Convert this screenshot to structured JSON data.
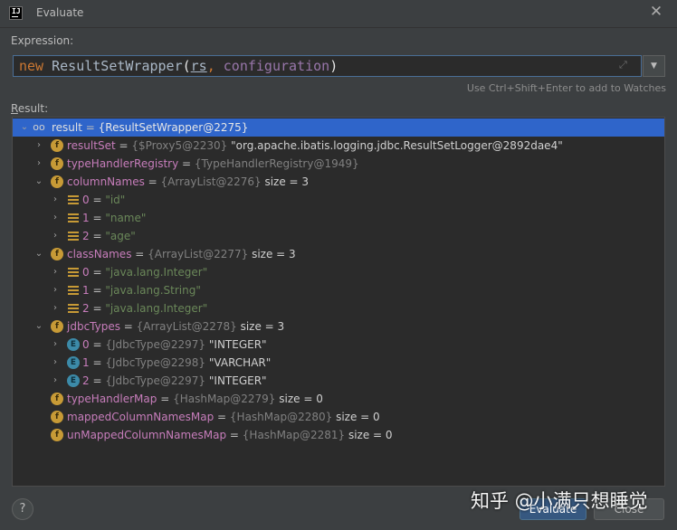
{
  "window": {
    "title": "Evaluate",
    "app_icon_text": "IJ"
  },
  "expression": {
    "label": "Expression:",
    "tokens": {
      "kw": "new",
      "cls": "ResultSetWrapper",
      "open": "(",
      "p1": "rs",
      "comma": ",",
      "p2": "configuration",
      "close": ")"
    },
    "hint": "Use Ctrl+Shift+Enter to add to Watches"
  },
  "result": {
    "label_u": "R",
    "label_rest": "esult:",
    "rows": [
      {
        "name": "result",
        "eq": " = ",
        "type": "{ResultSetWrapper@2275}",
        "tail": ""
      },
      {
        "name": "resultSet",
        "eq": " = ",
        "type": "{$Proxy5@2230}",
        "tail": " \"org.apache.ibatis.logging.jdbc.ResultSetLogger@2892dae4\""
      },
      {
        "name": "typeHandlerRegistry",
        "eq": " = ",
        "type": "{TypeHandlerRegistry@1949}",
        "tail": ""
      },
      {
        "name": "columnNames",
        "eq": " = ",
        "type": "{ArrayList@2276}",
        "tail": "  size = 3"
      },
      {
        "name": "0",
        "eq": " = ",
        "type": "",
        "tail": "\"id\""
      },
      {
        "name": "1",
        "eq": " = ",
        "type": "",
        "tail": "\"name\""
      },
      {
        "name": "2",
        "eq": " = ",
        "type": "",
        "tail": "\"age\""
      },
      {
        "name": "classNames",
        "eq": " = ",
        "type": "{ArrayList@2277}",
        "tail": "  size = 3"
      },
      {
        "name": "0",
        "eq": " = ",
        "type": "",
        "tail": "\"java.lang.Integer\""
      },
      {
        "name": "1",
        "eq": " = ",
        "type": "",
        "tail": "\"java.lang.String\""
      },
      {
        "name": "2",
        "eq": " = ",
        "type": "",
        "tail": "\"java.lang.Integer\""
      },
      {
        "name": "jdbcTypes",
        "eq": " = ",
        "type": "{ArrayList@2278}",
        "tail": "  size = 3"
      },
      {
        "name": "0",
        "eq": " = ",
        "type": "{JdbcType@2297}",
        "tail": " \"INTEGER\""
      },
      {
        "name": "1",
        "eq": " = ",
        "type": "{JdbcType@2298}",
        "tail": " \"VARCHAR\""
      },
      {
        "name": "2",
        "eq": " = ",
        "type": "{JdbcType@2297}",
        "tail": " \"INTEGER\""
      },
      {
        "name": "typeHandlerMap",
        "eq": " = ",
        "type": "{HashMap@2279}",
        "tail": "  size = 0"
      },
      {
        "name": "mappedColumnNamesMap",
        "eq": " = ",
        "type": "{HashMap@2280}",
        "tail": "  size = 0"
      },
      {
        "name": "unMappedColumnNamesMap",
        "eq": " = ",
        "type": "{HashMap@2281}",
        "tail": "  size = 0"
      }
    ]
  },
  "buttons": {
    "help": "?",
    "evaluate": "Evaluate",
    "close": "Close"
  },
  "watermark": "知乎 @小满只想睡觉",
  "colors": {
    "selection": "#2f65ca",
    "field_icon": "#c79a36",
    "enum_icon": "#3c8aa8",
    "string_value": "#6a8759"
  }
}
